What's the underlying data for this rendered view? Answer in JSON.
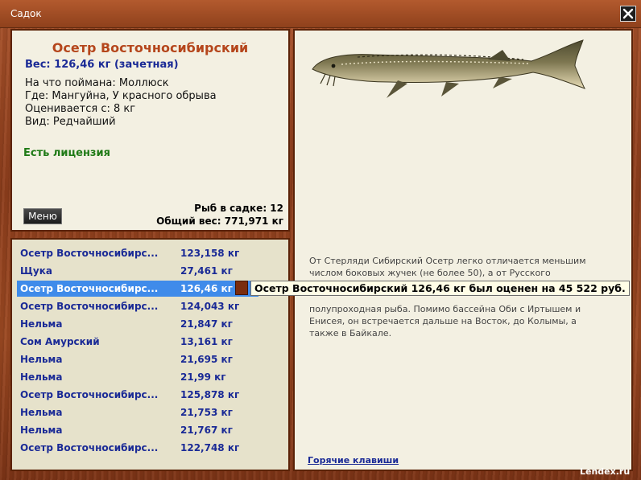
{
  "window": {
    "title": "Садок",
    "close": "×"
  },
  "catch": {
    "name": "Осетр Восточносибирский",
    "weight": "Вес: 126,46 кг (зачетная)",
    "bait": "На что поймана: Моллюск",
    "place": "Где: Мангуйна, У красного обрыва",
    "rated_from": "Оценивается с: 8 кг",
    "rarity": "Вид: Редчайший",
    "license": "Есть лицензия"
  },
  "cage": {
    "count": "Рыб в садке: 12",
    "total": "Общий вес: 771,971 кг"
  },
  "menu_button": "Меню",
  "fish_list": [
    {
      "name": "Осетр Восточносибирс...",
      "weight": "123,158 кг"
    },
    {
      "name": "Щука",
      "weight": "27,461 кг"
    },
    {
      "name": "Осетр Восточносибирс...",
      "weight": "126,46 кг"
    },
    {
      "name": "Осетр Восточносибирс...",
      "weight": "124,043 кг"
    },
    {
      "name": "Нельма",
      "weight": "21,847 кг"
    },
    {
      "name": "Сом Амурский",
      "weight": "13,161 кг"
    },
    {
      "name": "Нельма",
      "weight": "21,695 кг"
    },
    {
      "name": "Нельма",
      "weight": "21,99 кг"
    },
    {
      "name": "Осетр Восточносибирс...",
      "weight": "125,878 кг"
    },
    {
      "name": "Нельма",
      "weight": "21,753 кг"
    },
    {
      "name": "Нельма",
      "weight": "21,767 кг"
    },
    {
      "name": "Осетр Восточносибирс...",
      "weight": "122,748 кг"
    }
  ],
  "selected_index": 2,
  "tooltip": "Осетр Восточносибирский 126,46 кг был оценен на 45 522 руб.",
  "description": [
    "От Стерляди Сибирский Осетр легко отличается меньшим",
    "числом боковых жучек (не более 50), а от Русского",
    "полупроходная рыба. Помимо бассейна Оби с Иртышем и",
    "Енисея, он встречается дальше на Восток, до Колымы, а",
    "также в Байкале."
  ],
  "hotkeys_link": "Горячие клавиши",
  "watermark": "Lendex.ru",
  "icons": {
    "close": "close-icon",
    "fish": "sturgeon-image"
  },
  "colors": {
    "name": "#b5461c",
    "link": "#1a2a96",
    "license": "#1f7a16",
    "selected_row": "#3f8bea",
    "frame": "#8e3e1c"
  }
}
